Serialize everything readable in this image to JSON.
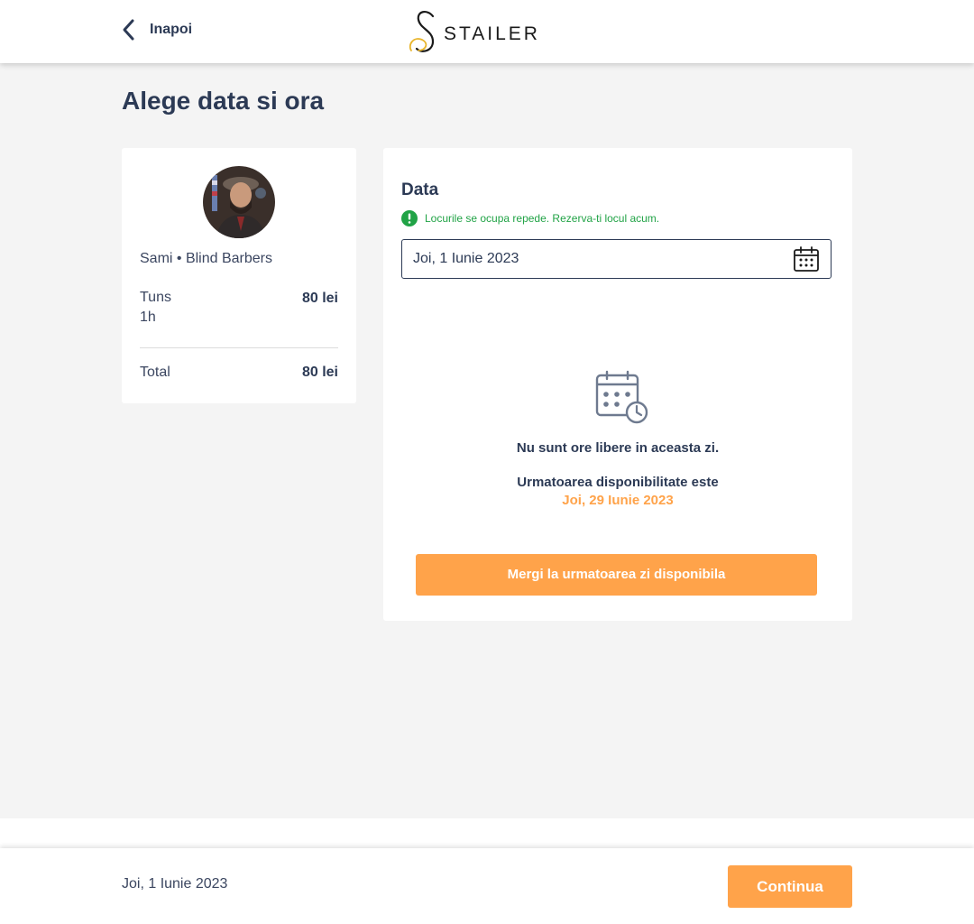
{
  "header": {
    "back_label": "Inapoi",
    "logo_text": "STAILER",
    "accent_color": "#ffa34a"
  },
  "page": {
    "title": "Alege data si ora"
  },
  "summary": {
    "barber_name": "Sami • Blind Barbers",
    "service": {
      "name": "Tuns",
      "duration": "1h",
      "price": "80 lei"
    },
    "total_label": "Total",
    "total_price": "80 lei"
  },
  "date_picker": {
    "heading": "Data",
    "notice": "Locurile se ocupa repede. Rezerva-ti locul acum.",
    "selected_date": "Joi, 1 Iunie 2023",
    "icon": "calendar-icon"
  },
  "availability": {
    "icon": "calendar-clock-icon",
    "empty_message": "Nu sunt ore libere in aceasta zi.",
    "next_label": "Urmatoarea disponibilitate este",
    "next_date": "Joi, 29 Iunie 2023",
    "next_button_label": "Mergi la urmatoarea zi disponibila"
  },
  "footer": {
    "selected_date": "Joi, 1 Iunie 2023",
    "continue_label": "Continua"
  }
}
